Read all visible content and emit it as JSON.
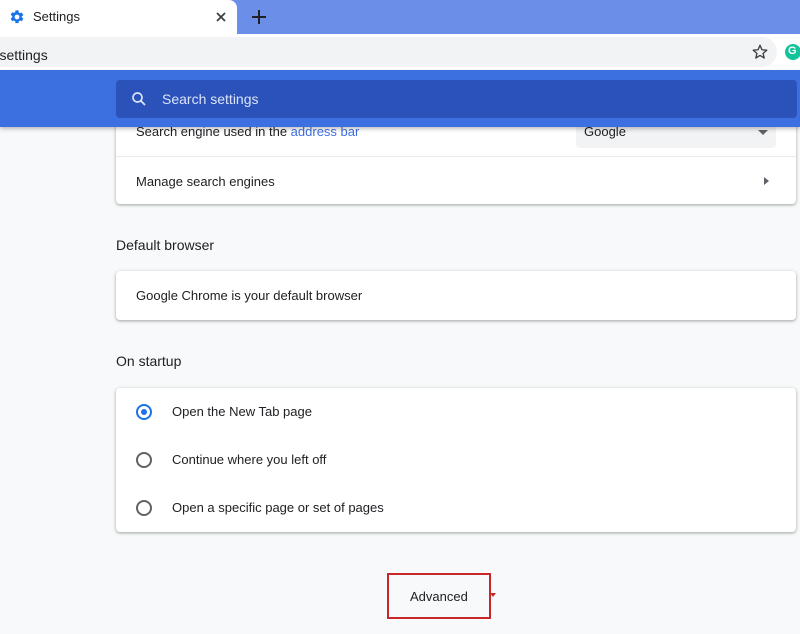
{
  "tab": {
    "title": "Settings",
    "favicon": "gear-icon"
  },
  "toolbar": {
    "url": "e://settings",
    "star": "star-icon",
    "extension": "G"
  },
  "search": {
    "placeholder": "Search settings"
  },
  "search_engine": {
    "label_prefix": "Search engine used in the ",
    "label_link": "address bar",
    "selected": "Google",
    "manage_label": "Manage search engines"
  },
  "default_browser": {
    "section_title": "Default browser",
    "status": "Google Chrome is your default browser"
  },
  "startup": {
    "section_title": "On startup",
    "options": [
      {
        "label": "Open the New Tab page",
        "checked": true
      },
      {
        "label": "Continue where you left off",
        "checked": false
      },
      {
        "label": "Open a specific page or set of pages",
        "checked": false
      }
    ]
  },
  "advanced": {
    "label": "Advanced"
  },
  "colors": {
    "accent": "#3c6fe0",
    "radio_selected": "#1a73e8",
    "highlight": "#c62828"
  }
}
